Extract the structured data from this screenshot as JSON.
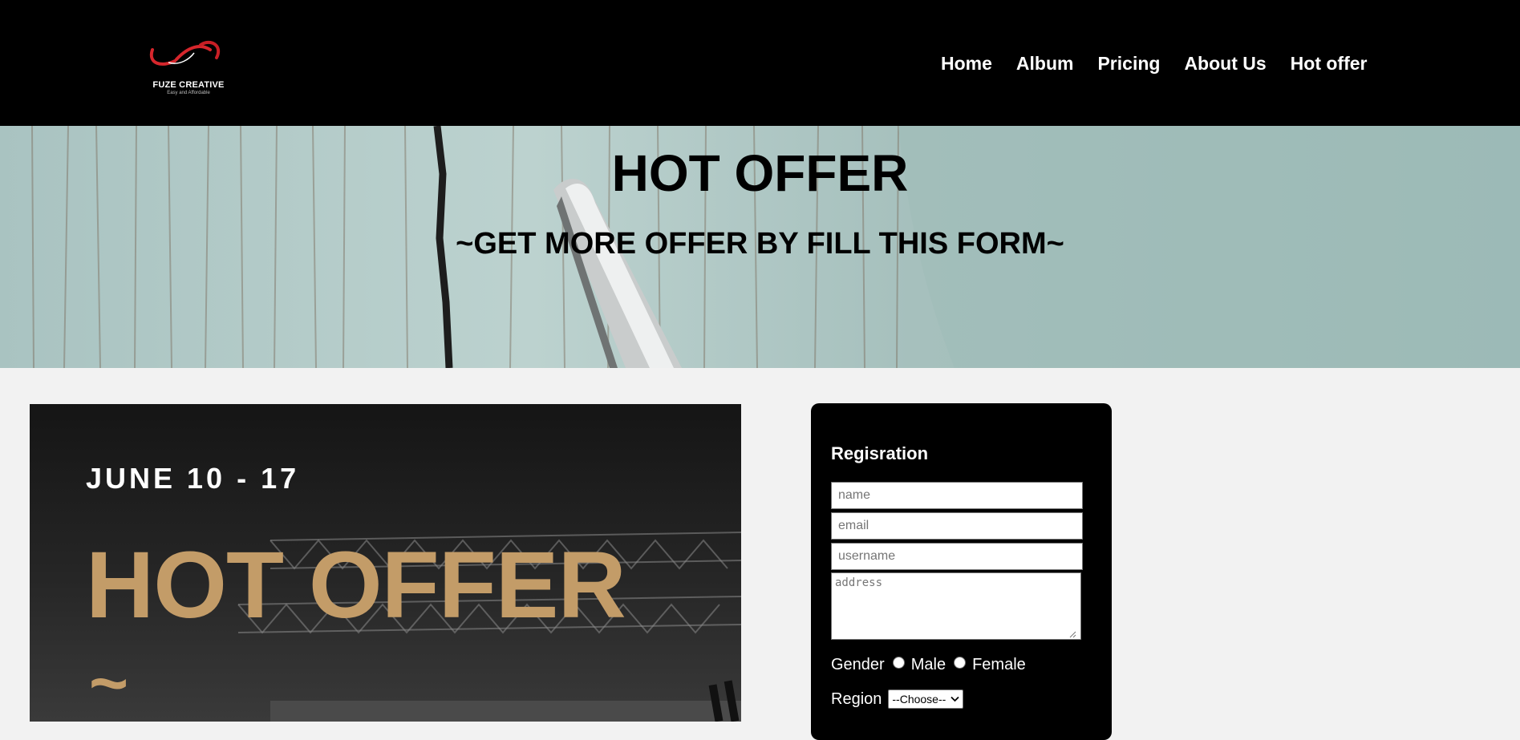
{
  "nav": {
    "logo_text": "FUZE CREATIVE",
    "logo_tagline": "Easy and Affordable",
    "links": [
      {
        "label": "Home"
      },
      {
        "label": "Album"
      },
      {
        "label": "Pricing"
      },
      {
        "label": "About Us"
      },
      {
        "label": "Hot offer"
      }
    ]
  },
  "hero": {
    "title": "HOT OFFER",
    "subtitle": "~GET MORE OFFER BY FILL THIS FORM~"
  },
  "poster": {
    "date": "JUNE 10 - 17",
    "title": "HOT OFFER",
    "tilde": "~"
  },
  "form": {
    "title": "Regisration",
    "name_placeholder": "name",
    "email_placeholder": "email",
    "username_placeholder": "username",
    "address_placeholder": "address",
    "gender_label": "Gender",
    "gender_options": [
      "Male",
      "Female"
    ],
    "region_label": "Region",
    "region_selected": "--Choose--"
  },
  "colors": {
    "nav_bg": "#000000",
    "page_bg": "#f2f2f2",
    "poster_accent": "#c39c68",
    "logo_red": "#d6262c"
  }
}
